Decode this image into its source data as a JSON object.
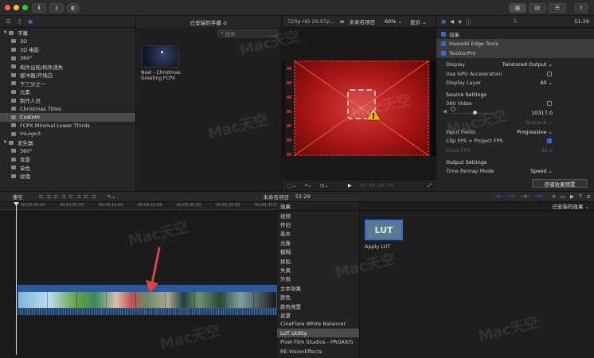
{
  "toolbar": {
    "ratings_icon": "key-icon",
    "right_badge": "MB"
  },
  "library": {
    "items": [
      {
        "label": "字幕",
        "level": 0,
        "expanded": true,
        "selected": false
      },
      {
        "label": "3D",
        "level": 1,
        "selected": false
      },
      {
        "label": "3D 电影",
        "level": 1,
        "selected": false
      },
      {
        "label": "360°",
        "level": 1,
        "selected": false
      },
      {
        "label": "构件出现/构件消失",
        "level": 1,
        "selected": false
      },
      {
        "label": "缓冲器/开场白",
        "level": 1,
        "selected": false
      },
      {
        "label": "下三分之一",
        "level": 1,
        "selected": false
      },
      {
        "label": "元素",
        "level": 1,
        "selected": false
      },
      {
        "label": "制作人员",
        "level": 1,
        "selected": false
      },
      {
        "label": "Christmas Titles",
        "level": 1,
        "selected": false
      },
      {
        "label": "Custom",
        "level": 1,
        "selected": true
      },
      {
        "label": "FCPX Minimal Lower Thirds",
        "level": 1,
        "selected": false
      },
      {
        "label": "mLogo3",
        "level": 1,
        "selected": false
      },
      {
        "label": "发生器",
        "level": 0,
        "expanded": true,
        "selected": false
      },
      {
        "label": "360°",
        "level": 1,
        "selected": false
      },
      {
        "label": "背景",
        "level": 1,
        "selected": false
      },
      {
        "label": "单色",
        "level": 1,
        "selected": false
      },
      {
        "label": "纹理",
        "level": 1,
        "selected": false
      }
    ]
  },
  "browser": {
    "category": "已安装的字幕 ≎",
    "search_placeholder": "搜索",
    "clip_title": "Noel - Christmas Greeting FCPX"
  },
  "viewer": {
    "format": "720p HD 29.97p...",
    "project": "未命名项目",
    "zoom": "60% ⌄",
    "display": "显示 ⌄",
    "timecode": "00:00:00:00"
  },
  "inspector": {
    "timecode": "51:29",
    "section_effects": "效果",
    "effects": [
      {
        "label": "Hawaiki Edge Tools",
        "checked": true
      },
      {
        "label": "TwixtorPro",
        "checked": true
      }
    ],
    "params": [
      {
        "label": "Display",
        "value": "Twixtored Output ⌄"
      },
      {
        "label": "Use GPU Acceleration",
        "checkbox": false
      },
      {
        "label": "Display Layer",
        "value": "All ⌄"
      }
    ],
    "source_settings": "Source Settings",
    "params2": [
      {
        "label": "360 Video",
        "checkbox": false
      },
      {
        "label": "",
        "value": "10317.0"
      },
      {
        "label": "",
        "value": "Scene A ⌄",
        "dim": true
      },
      {
        "label": "Input Fields",
        "value": "Progressive ⌄"
      },
      {
        "label": "Clip FPS = Project FPS",
        "checkbox": true
      },
      {
        "label": "Input FPS",
        "value": "30.0",
        "dim": true
      }
    ],
    "output_settings": "Output Settings",
    "params3": [
      {
        "label": "Time Remap Mode",
        "value": "Speed ⌄"
      }
    ],
    "save_preset": "存储效果预置"
  },
  "timeline_bar": {
    "index": "索引",
    "project": "未命名项目",
    "duration": "51:29"
  },
  "timeline": {
    "ruler": [
      "00:00:00:00",
      "00:00:05:00",
      "00:00:10:00",
      "00:00:15:00",
      "00:00:20:00",
      "00:00:25:00",
      "00:00:30:00"
    ]
  },
  "effects_panel": {
    "title": "效果",
    "installed": "已安装的效果 ⌄",
    "categories": [
      "视频",
      "怀旧",
      "基本",
      "光像",
      "模糊",
      "拼贴",
      "失真",
      "外观",
      "文本效果",
      "颜色",
      "颜色预置",
      "遮罩",
      "CineFlare White Balancer",
      "LUT Utility",
      "Pixel Film Studios - PROAXIS",
      "RE:VisionEffects"
    ],
    "selected_index": 13,
    "tile_label": "LUT",
    "tile_name": "Apply LUT"
  },
  "watermark": {
    "brand": "Mac天空",
    "url": "www.mac69.com"
  },
  "colors": {
    "accent": "#2f6ae0",
    "viewer_red": "#b01a1a",
    "warning": "#f0b000",
    "arrow": "#e04040"
  }
}
